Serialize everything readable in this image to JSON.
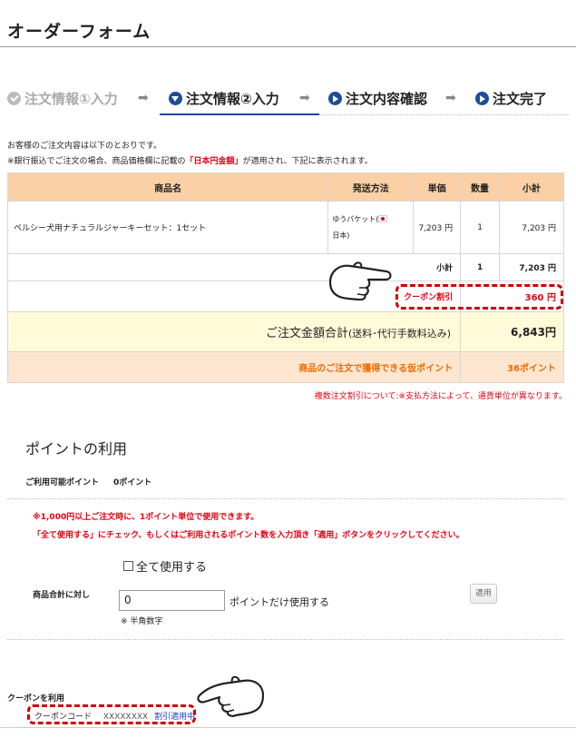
{
  "page": {
    "title": "オーダーフォーム"
  },
  "steps": [
    {
      "label": "注文情報①入力",
      "state": "done"
    },
    {
      "label": "注文情報②入力",
      "state": "current"
    },
    {
      "label": "注文内容確認",
      "state": "todo"
    },
    {
      "label": "注文完了",
      "state": "todo"
    }
  ],
  "notes": {
    "line1": "お客様のご注文内容は以下のとおりです。",
    "line2_a": "※銀行振込でご注文の場合、商品価格欄に記載の",
    "line2_highlight": "「日本円金額」",
    "line2_b": "が適用され、下記に表示されます。"
  },
  "table": {
    "headers": {
      "item": "商品名",
      "shipping": "発送方法",
      "unit_price": "単価",
      "qty": "数量",
      "subtotal": "小計"
    },
    "row": {
      "item": "ペルシー犬用ナチュラルジャーキーセット：1セット",
      "shipping_a": "ゆうパケット(",
      "shipping_b": "日本)",
      "unit_price": "7,203 円",
      "qty": "1",
      "subtotal": "7,203 円"
    },
    "subtotal_label": "小計",
    "subtotal_qty": "1",
    "subtotal_value": "7,203 円",
    "coupon_label": "クーポン割引",
    "coupon_value": "360 円",
    "total_label": "ご注文金額合計",
    "total_note": "(送料･代行手数料込み)",
    "total_value": "6,843円",
    "points_label": "商品のご注文で獲得できる仮ポイント",
    "points_value": "36ポイント"
  },
  "currency_note": "複数注文割引について:※支払方法によって、通貨単位が異なります。",
  "points_section": {
    "title": "ポイントの利用",
    "available_label": "ご利用可能ポイント",
    "available_value": "0ポイント",
    "rule1": "※1,000円以上ご注文時に、1ポイント単位で使用できます。",
    "rule2": "「全て使用する」にチェック、もしくはご利用されるポイント数を入力頂き「適用」ボタンをクリックしてください。",
    "use_all_label": "全て使用する",
    "against_label": "商品合計に対し",
    "input_value": "0",
    "after_input": "ポイントだけ使用する",
    "hankaku": "※ 半角数字",
    "apply_label": "適用"
  },
  "coupon_section": {
    "title": "クーポンを利用",
    "code_label": "クーポンコード",
    "code_value": "XXXXXXXX",
    "status": "割引適用中"
  }
}
